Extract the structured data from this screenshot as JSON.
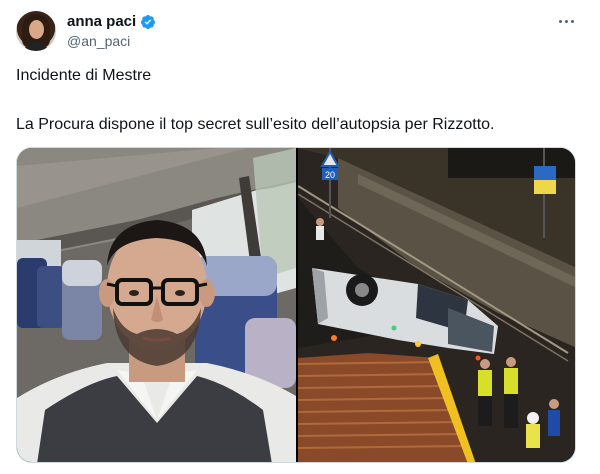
{
  "author": {
    "name": "anna paci",
    "handle": "@an_paci",
    "verified": true,
    "avatar_icon": "avatar-photo"
  },
  "menu": {
    "icon": "more-dots-icon"
  },
  "tweet": {
    "line1": "Incidente di Mestre",
    "line2": "La Procura dispone il top secret sull’esito dell’autopsia per Rizzotto."
  },
  "media": {
    "left_photo": "man-selfie-in-bus-photo",
    "right_photo": "bus-crash-scene-photo",
    "sign_number": "20"
  },
  "colors": {
    "text": "#0f1419",
    "secondary": "#536471",
    "verified_blue": "#1d9bf0",
    "border": "#cfd9de"
  }
}
